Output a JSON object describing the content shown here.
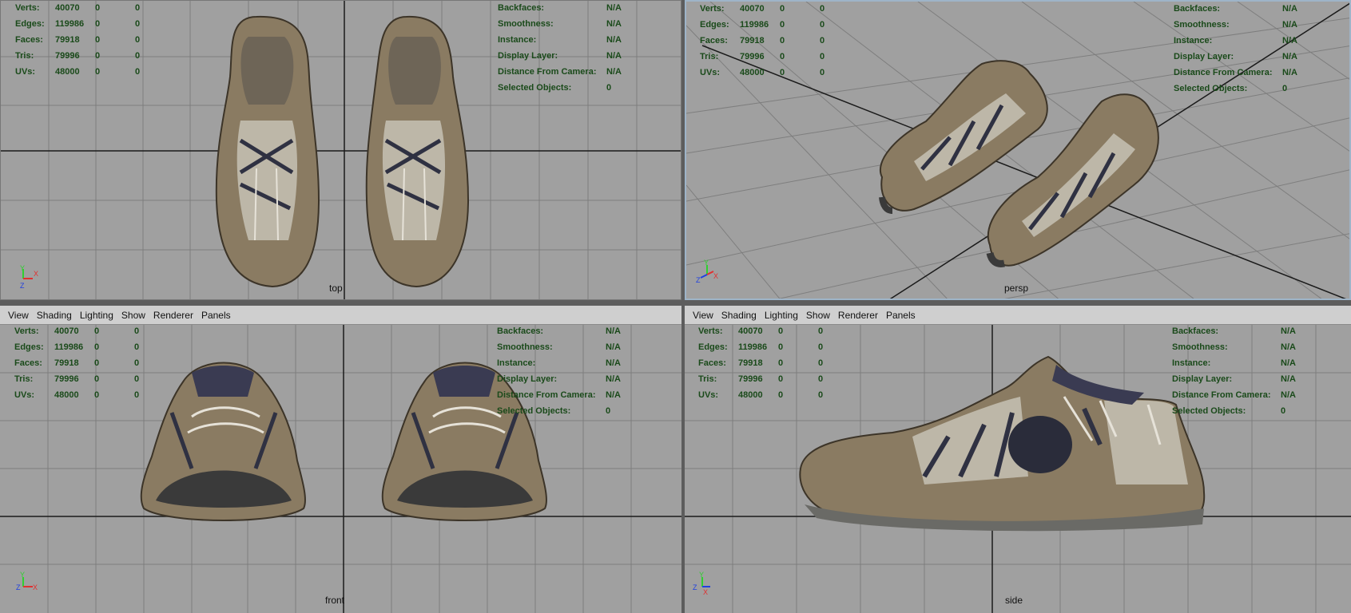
{
  "menu": [
    "View",
    "Shading",
    "Lighting",
    "Show",
    "Renderer",
    "Panels"
  ],
  "hud_left": [
    {
      "label": "Verts:",
      "v1": "40070",
      "v2": "0",
      "v3": "0"
    },
    {
      "label": "Edges:",
      "v1": "119986",
      "v2": "0",
      "v3": "0"
    },
    {
      "label": "Faces:",
      "v1": "79918",
      "v2": "0",
      "v3": "0"
    },
    {
      "label": "Tris:",
      "v1": "79996",
      "v2": "0",
      "v3": "0"
    },
    {
      "label": "UVs:",
      "v1": "48000",
      "v2": "0",
      "v3": "0"
    }
  ],
  "hud_right": [
    {
      "label": "Backfaces:",
      "value": "N/A"
    },
    {
      "label": "Smoothness:",
      "value": "N/A"
    },
    {
      "label": "Instance:",
      "value": "N/A"
    },
    {
      "label": "Display Layer:",
      "value": "N/A"
    },
    {
      "label": "Distance From Camera:",
      "value": "N/A"
    },
    {
      "label": "Selected Objects:",
      "value": "0"
    }
  ],
  "panes": {
    "top": {
      "camera": "top"
    },
    "persp": {
      "camera": "persp"
    },
    "front": {
      "camera": "front"
    },
    "side": {
      "camera": "side"
    }
  },
  "colors": {
    "viewport_bg": "#a0a0a0",
    "grid": "#7e7e7e",
    "axis_line": "#1a1a1a",
    "hud_text": "#1a4a1a",
    "active_border": "#9eb4c8"
  }
}
